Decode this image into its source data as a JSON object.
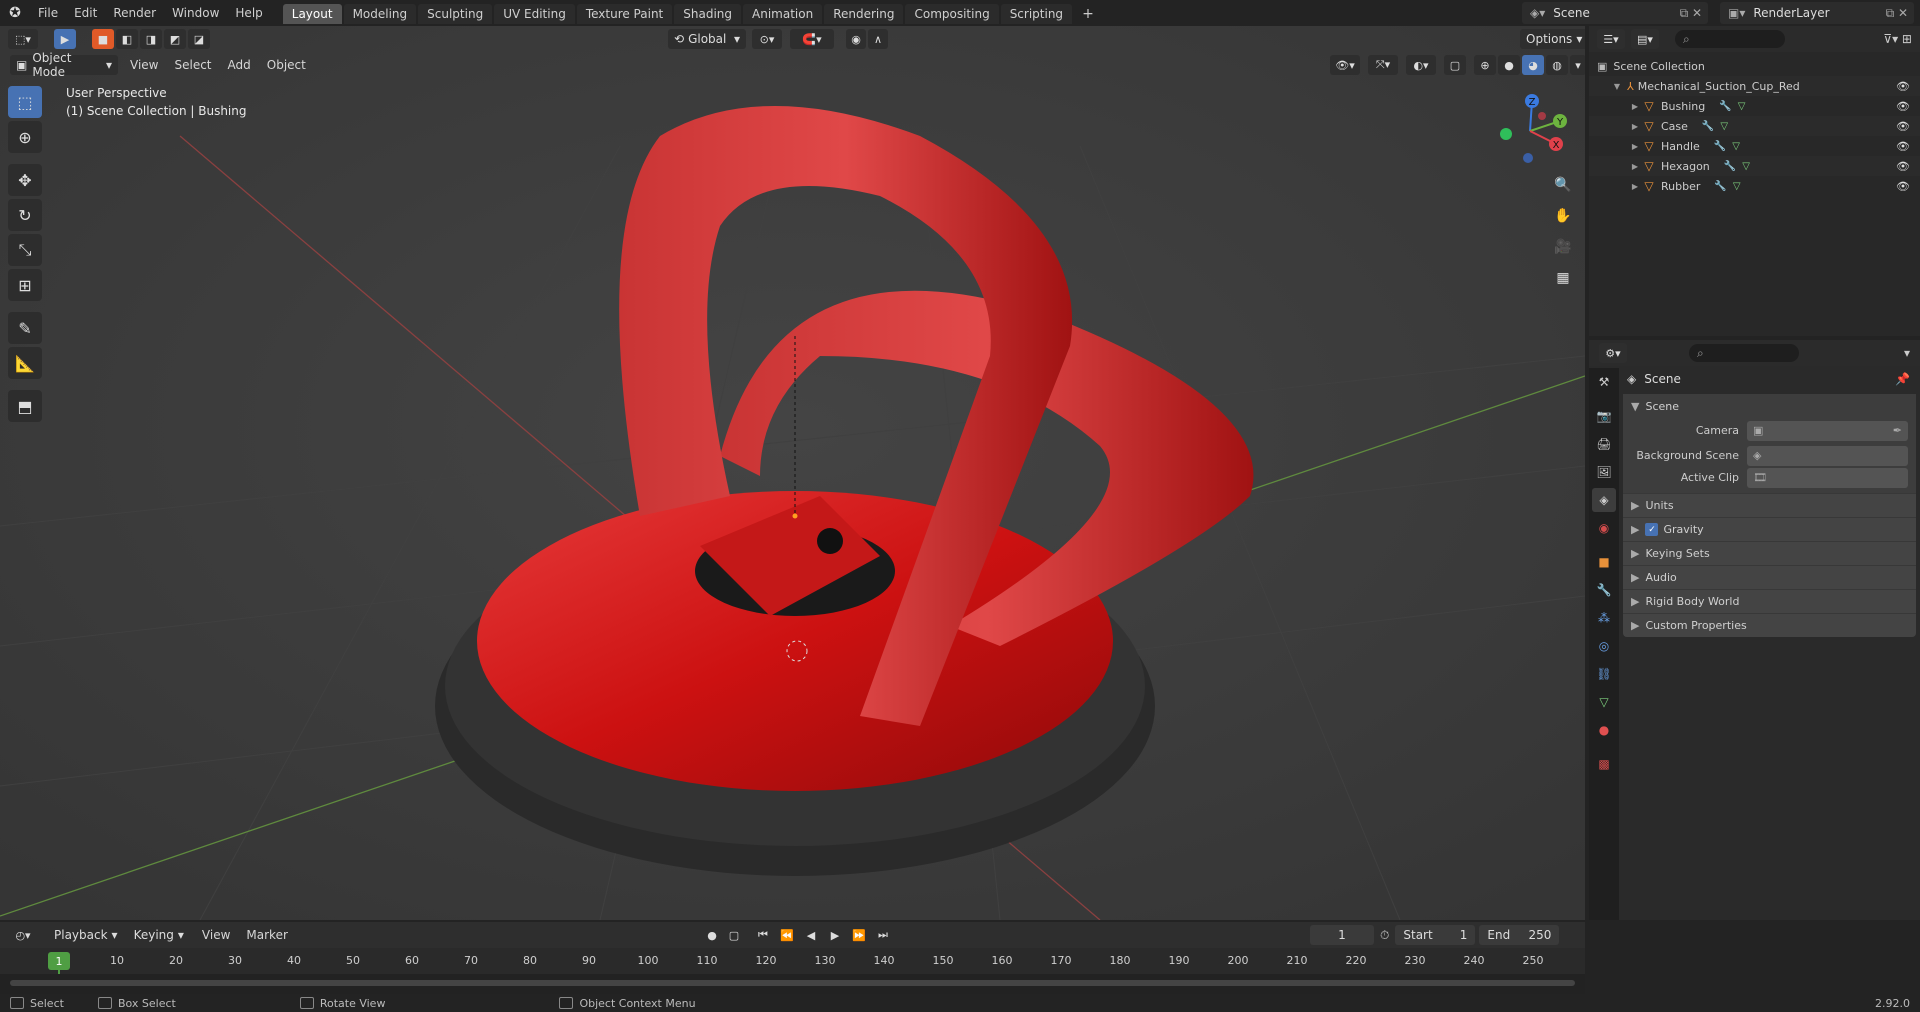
{
  "app": {
    "menus": [
      "File",
      "Edit",
      "Render",
      "Window",
      "Help"
    ],
    "workspaces": [
      "Layout",
      "Modeling",
      "Sculpting",
      "UV Editing",
      "Texture Paint",
      "Shading",
      "Animation",
      "Rendering",
      "Compositing",
      "Scripting"
    ],
    "active_workspace": "Layout",
    "scene_name": "Scene",
    "view_layer": "RenderLayer",
    "version": "2.92.0"
  },
  "viewport": {
    "mode": "Object Mode",
    "menus": [
      "View",
      "Select",
      "Add",
      "Object"
    ],
    "orientation": "Global",
    "options_label": "Options",
    "info_line1": "User Perspective",
    "info_line2": "(1) Scene Collection | Bushing",
    "gizmo_labels": {
      "x": "X",
      "y": "Y",
      "z": "Z"
    }
  },
  "outliner": {
    "root": "Scene Collection",
    "collection": "Mechanical_Suction_Cup_Red",
    "objects": [
      "Bushing",
      "Case",
      "Handle",
      "Hexagon",
      "Rubber"
    ]
  },
  "properties": {
    "context_title": "Scene",
    "panel": "Scene",
    "fields": [
      {
        "label": "Camera",
        "value": ""
      },
      {
        "label": "Background Scene",
        "value": ""
      },
      {
        "label": "Active Clip",
        "value": ""
      }
    ],
    "subpanels": [
      "Units",
      "Gravity",
      "Keying Sets",
      "Audio",
      "Rigid Body World",
      "Custom Properties"
    ],
    "gravity_checked": true
  },
  "timeline": {
    "menus": [
      "Playback",
      "Keying",
      "View",
      "Marker"
    ],
    "current_frame": "1",
    "start_label": "Start",
    "start": "1",
    "end_label": "End",
    "end": "250",
    "ruler": [
      "10",
      "20",
      "30",
      "40",
      "50",
      "60",
      "70",
      "80",
      "90",
      "100",
      "110",
      "120",
      "130",
      "140",
      "150",
      "160",
      "170",
      "180",
      "190",
      "200",
      "210",
      "220",
      "230",
      "240",
      "250"
    ]
  },
  "status": {
    "select": "Select",
    "box_select": "Box Select",
    "rotate": "Rotate View",
    "context_menu": "Object Context Menu"
  },
  "colors": {
    "accent": "#4772b3",
    "object_red": "#d11414",
    "rubber": "#2a2a2a",
    "frame_green": "#4f9e43"
  }
}
